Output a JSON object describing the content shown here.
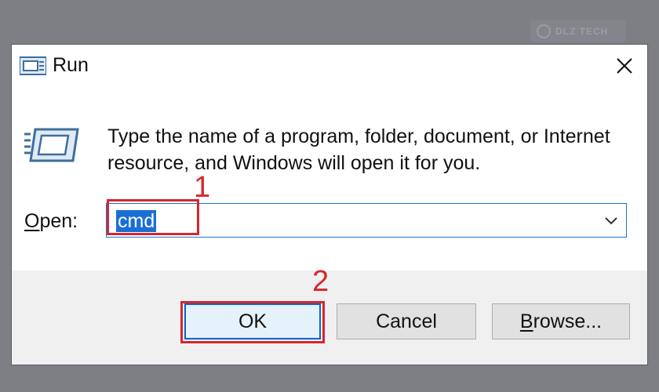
{
  "watermark": {
    "text": "DLZ TECH"
  },
  "dialog": {
    "title": "Run",
    "icons": {
      "title_icon": "run-icon",
      "large_icon": "run-icon",
      "close": "close-icon",
      "dropdown": "chevron-down-icon"
    },
    "description": "Type the name of a program, folder, document, or Internet resource, and Windows will open it for you.",
    "open_label_mnemonic": "O",
    "open_label_rest": "pen:",
    "open_value": "cmd",
    "buttons": {
      "ok": "OK",
      "cancel": "Cancel",
      "browse_mnemonic": "B",
      "browse_rest": "rowse..."
    }
  },
  "annotations": {
    "step1": "1",
    "step2": "2",
    "color": "#d6262c"
  },
  "colors": {
    "selection": "#1a6fd6",
    "focus_border": "#0a64c8",
    "footer_bg": "#f0f0f0",
    "backdrop": "#7e7e85"
  }
}
